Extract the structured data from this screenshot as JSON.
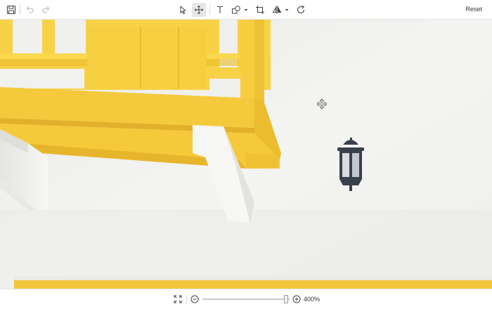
{
  "toolbar": {
    "save_icon": "save-icon",
    "undo_icon": "undo-icon",
    "redo_icon": "redo-icon",
    "select_icon": "cursor-icon",
    "pan_icon": "move-icon",
    "text_icon": "text-icon",
    "shapes_icon": "shapes-icon",
    "crop_icon": "crop-icon",
    "flip_icon": "flip-icon",
    "rotate_icon": "rotate-icon",
    "active_tool": "pan",
    "reset_label": "Reset"
  },
  "bottombar": {
    "fit_icon": "fit-screen-icon",
    "zoom_out_icon": "zoom-out-icon",
    "zoom_in_icon": "zoom-in-icon",
    "zoom_level_label": "400%",
    "zoom_slider_fraction": 0.98
  },
  "colors": {
    "wall": "#f2f2f0",
    "balcony_yellow": "#f6cf43",
    "balcony_shadow": "#e3b323",
    "lamp": "#39404d"
  }
}
